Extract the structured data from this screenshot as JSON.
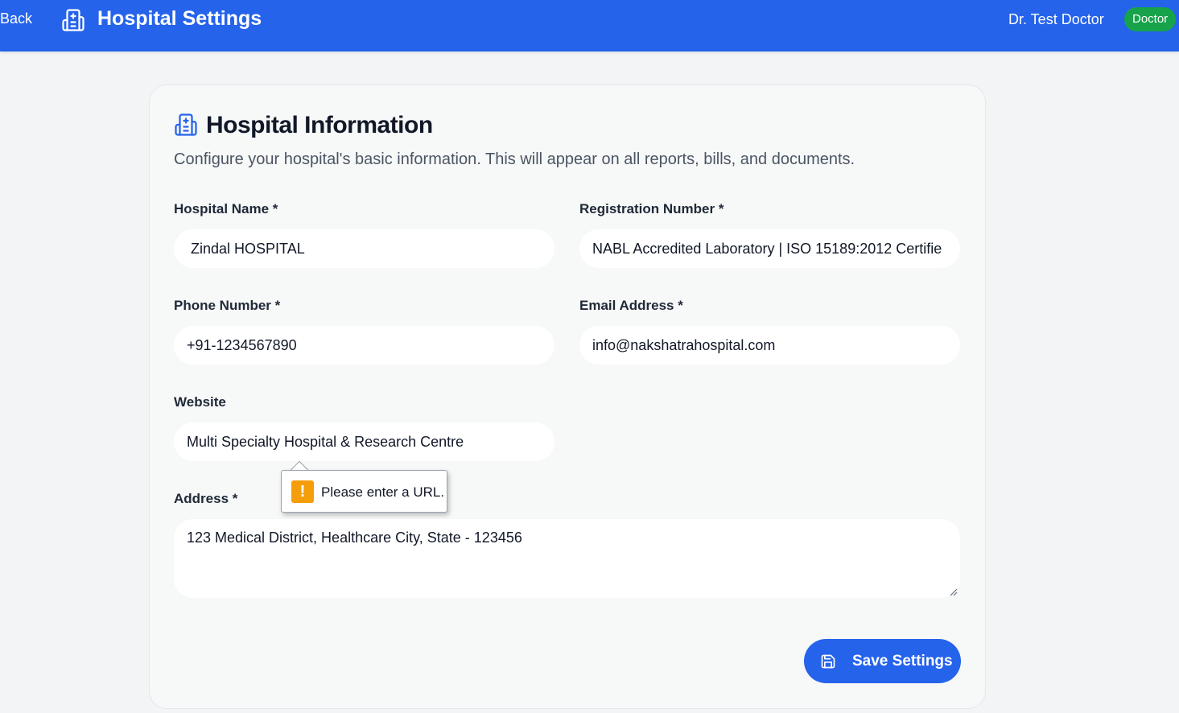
{
  "header": {
    "back_label": "Back",
    "title": "Hospital Settings",
    "user_name": "Dr. Test Doctor",
    "role": "Doctor"
  },
  "card": {
    "title": "Hospital Information",
    "description": "Configure your hospital's basic information. This will appear on all reports, bills, and documents."
  },
  "form": {
    "hospital_name": {
      "label": "Hospital Name *",
      "value": " Zindal HOSPITAL"
    },
    "registration_number": {
      "label": "Registration Number *",
      "value": "NABL Accredited Laboratory | ISO 15189:2012 Certifie"
    },
    "phone": {
      "label": "Phone Number *",
      "value": "+91-1234567890"
    },
    "email": {
      "label": "Email Address *",
      "value": "info@nakshatrahospital.com"
    },
    "website": {
      "label": "Website",
      "value": "Multi Specialty Hospital & Research Centre"
    },
    "address": {
      "label": "Address *",
      "value": "123 Medical District, Healthcare City, State - 123456"
    }
  },
  "validation_tooltip": {
    "icon": "!",
    "message": "Please enter a URL."
  },
  "save_button": {
    "label": "Save Settings"
  },
  "colors": {
    "primary": "#2563eb",
    "badge": "#16a34a",
    "warning": "#f59e0b"
  }
}
